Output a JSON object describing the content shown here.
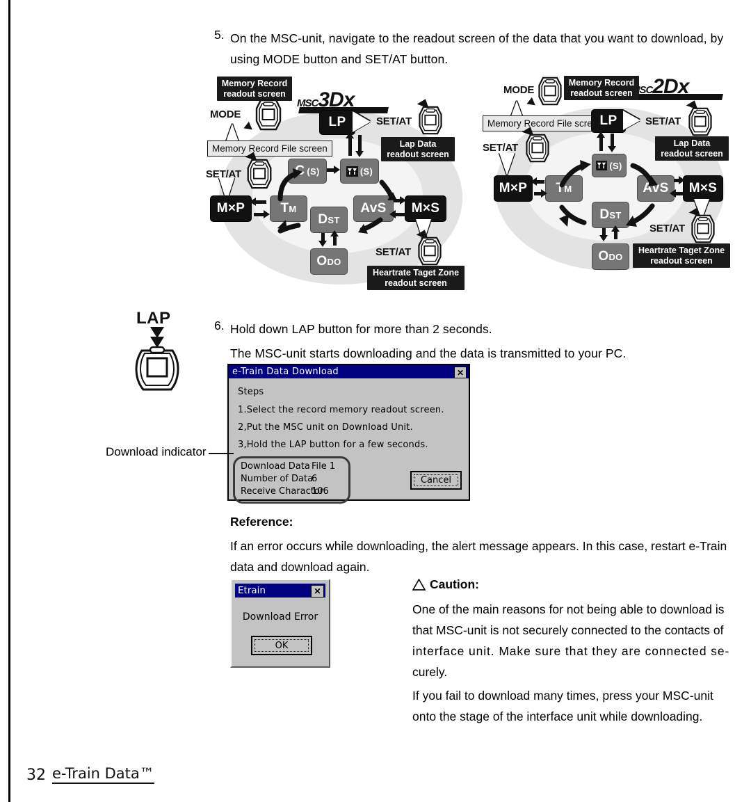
{
  "page": {
    "number": "32",
    "brand": "e-Train Data™"
  },
  "steps": [
    {
      "num": "5.",
      "line1": "On the MSC-unit, navigate to the readout screen of the data that you want to download, by",
      "line2": "using MODE button and SET/AT button."
    },
    {
      "num": "6.",
      "line1": "Hold down LAP button for more than 2 seconds.",
      "line2": "The MSC-unit starts downloading and the data is transmitted to your PC."
    }
  ],
  "lap_button_label": "LAP",
  "download_indicator_label": "Download indicator",
  "diagram_left": {
    "model_logo_prefix": "MSC",
    "model_logo_num": "3",
    "model_logo_suffix": "Dx",
    "callouts": {
      "memory_record_readout": "Memory Record\nreadout screen",
      "lap_data_readout": "Lap Data\nreadout screen",
      "heartrate_readout": "Heartrate Taget Zone\nreadout screen"
    },
    "file_screen_box": "Memory Record File screen",
    "buttons": {
      "mode": "MODE",
      "set_at_left": "SET/AT",
      "set_at_top": "SET/AT",
      "set_at_bottom": "SET/AT"
    },
    "nodes": {
      "lp": "LP",
      "c_s_main": "C",
      "c_s_sub": "(S)",
      "hr_s_sub": "(S)",
      "mxp": "M×P",
      "tm_main": "T",
      "tm_sub": "M",
      "dst_main": "D",
      "dst_sub": "ST",
      "avs": "AvS",
      "mxs": "M×S",
      "odo_main": "O",
      "odo_sub": "DO"
    }
  },
  "diagram_right": {
    "model_logo_prefix": "MSC",
    "model_logo_num": "2",
    "model_logo_suffix": "Dx",
    "callouts": {
      "memory_record_readout": "Memory Record\nreadout screen",
      "lap_data_readout": "Lap Data\nreadout screen",
      "heartrate_readout": "Heartrate Taget Zone\nreadout screen"
    },
    "file_screen_box": "Memory Record File screen",
    "buttons": {
      "mode": "MODE",
      "set_at_left": "SET/AT",
      "set_at_top": "SET/AT",
      "set_at_bottom": "SET/AT"
    },
    "nodes": {
      "lp": "LP",
      "hr_s_sub": "(S)",
      "mxp": "M×P",
      "tm_main": "T",
      "tm_sub": "M",
      "dst_main": "D",
      "dst_sub": "ST",
      "avs": "AvS",
      "mxs": "M×S",
      "odo_main": "O",
      "odo_sub": "DO"
    }
  },
  "download_dialog": {
    "title": "e-Train Data Download",
    "close_glyph": "✕",
    "heading": "Steps",
    "steps": [
      "1.Select the record memory readout screen.",
      "2,Put the MSC unit on Download Unit.",
      "3,Hold the LAP button for a few seconds."
    ],
    "indicator": [
      {
        "label": "Download Data",
        "value": "File 1"
      },
      {
        "label": "Number of Data",
        "value": "6"
      },
      {
        "label": "Receive Charactor",
        "value": "106"
      }
    ],
    "cancel_label": "Cancel"
  },
  "error_dialog": {
    "title": "Etrain",
    "close_glyph": "✕",
    "message": "Download  Error",
    "ok_label": "OK"
  },
  "reference": {
    "heading": "Reference:",
    "line1": "If an error occurs while downloading, the alert message appears. In this case, restart e-Train",
    "line2": "data and download again."
  },
  "caution": {
    "heading": "Caution:",
    "warning_glyph": "⚠",
    "para1_line1": "One of the main reasons for not being able to download is",
    "para1_line2": "that MSC-unit is not securely connected to the contacts of",
    "para1_line3": "interface unit. Make sure that they are connected se-",
    "para1_line4": "curely.",
    "para2_line1": "If you fail to download many times, press your MSC-unit",
    "para2_line2": "onto the stage of the interface unit while downloading."
  },
  "colors": {
    "node_gray": "#767676",
    "node_black": "#111111",
    "callout_bg": "#1a1a1a",
    "blob": "#e3e3e3",
    "dialog_titlebar": "#000080",
    "dialog_face": "#c3c3c3"
  }
}
